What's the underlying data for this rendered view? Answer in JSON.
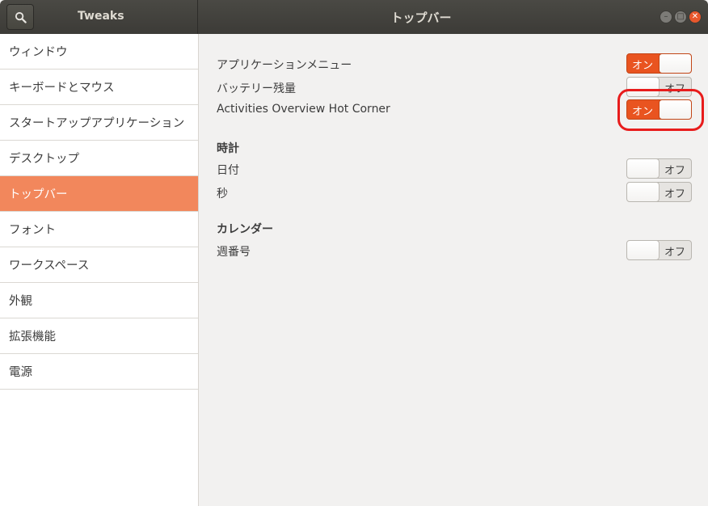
{
  "app": {
    "title": "Tweaks"
  },
  "page": {
    "title": "トップバー"
  },
  "sidebar": {
    "items": [
      {
        "label": "ウィンドウ"
      },
      {
        "label": "キーボードとマウス"
      },
      {
        "label": "スタートアップアプリケーション"
      },
      {
        "label": "デスクトップ"
      },
      {
        "label": "トップバー",
        "active": true
      },
      {
        "label": "フォント"
      },
      {
        "label": "ワークスペース"
      },
      {
        "label": "外観"
      },
      {
        "label": "拡張機能"
      },
      {
        "label": "電源"
      }
    ]
  },
  "settings": {
    "app_menu": {
      "label": "アプリケーションメニュー",
      "state": "オン"
    },
    "battery": {
      "label": "バッテリー残量",
      "state": "オフ"
    },
    "hot_corner": {
      "label": "Activities Overview Hot Corner",
      "state": "オン"
    },
    "clock": {
      "title": "時計",
      "date": {
        "label": "日付",
        "state": "オフ"
      },
      "seconds": {
        "label": "秒",
        "state": "オフ"
      }
    },
    "calendar": {
      "title": "カレンダー",
      "week": {
        "label": "週番号",
        "state": "オフ"
      }
    }
  },
  "colors": {
    "accent": "#e95420",
    "active_row": "#f2875c",
    "highlight": "#e81c1c"
  },
  "icons": {
    "search": "search-icon",
    "minimize": "minimize-icon",
    "maximize": "maximize-icon",
    "close": "close-icon"
  }
}
